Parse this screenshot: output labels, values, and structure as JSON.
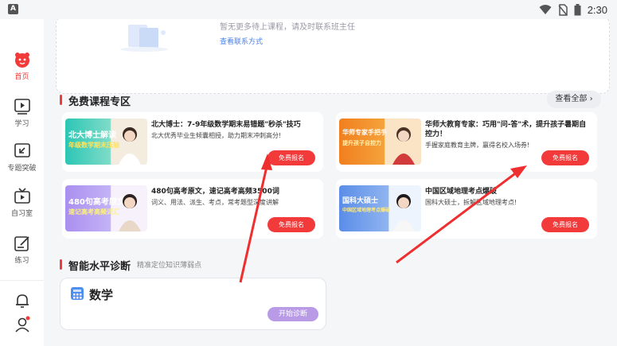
{
  "status_bar": {
    "app_badge": "A",
    "time": "2:30"
  },
  "sidebar": {
    "items": [
      {
        "label": "首页",
        "icon": "home-face-icon",
        "active": true
      },
      {
        "label": "学习",
        "icon": "play-book-icon"
      },
      {
        "label": "专题突破",
        "icon": "breakthrough-icon"
      },
      {
        "label": "自习室",
        "icon": "tv-icon"
      },
      {
        "label": "练习",
        "icon": "edit-icon"
      }
    ],
    "bell_icon": "bell-icon",
    "profile_icon": "profile-icon"
  },
  "pending_courses": {
    "message": "暂无更多待上课程，请及时联系班主任",
    "link": "查看联系方式"
  },
  "free_section": {
    "title": "免费课程专区",
    "view_all": "查看全部",
    "courses": [
      {
        "title": "北大博士：7-9年级数学期末易错题\"秒杀\"技巧",
        "desc": "北大优秀毕业生倾囊相授，助力期末冲刺高分!",
        "button": "免费报名",
        "thumb_text": "北大博士解读",
        "thumb_sub": "年级数学期末压轴"
      },
      {
        "title": "华师大教育专家：巧用\"问-答\"术，提升孩子暑期自控力！",
        "desc": "手握家庭教育主牌，赢得名校入场券!",
        "button": "免费报名",
        "thumb_text": "华师专家手把手",
        "thumb_sub": "提升孩子自控力"
      },
      {
        "title": "480句高考原文，速记高考高频3500词",
        "desc": "词义、用法、派生、考点，常考题型深度讲解",
        "button": "免费报名",
        "thumb_text": "480句高考原文",
        "thumb_sub": "速记高考高频词汇"
      },
      {
        "title": "中国区域地理考点爆破",
        "desc": "国科大硕士，拆解区域地理考点!",
        "button": "免费报名",
        "thumb_text": "国科大硕士",
        "thumb_sub": "中国区域地理考点爆破"
      }
    ]
  },
  "diagnosis_section": {
    "title": "智能水平诊断",
    "subtitle": "精准定位知识薄弱点",
    "subject": "数学",
    "button": "开始诊断"
  }
}
